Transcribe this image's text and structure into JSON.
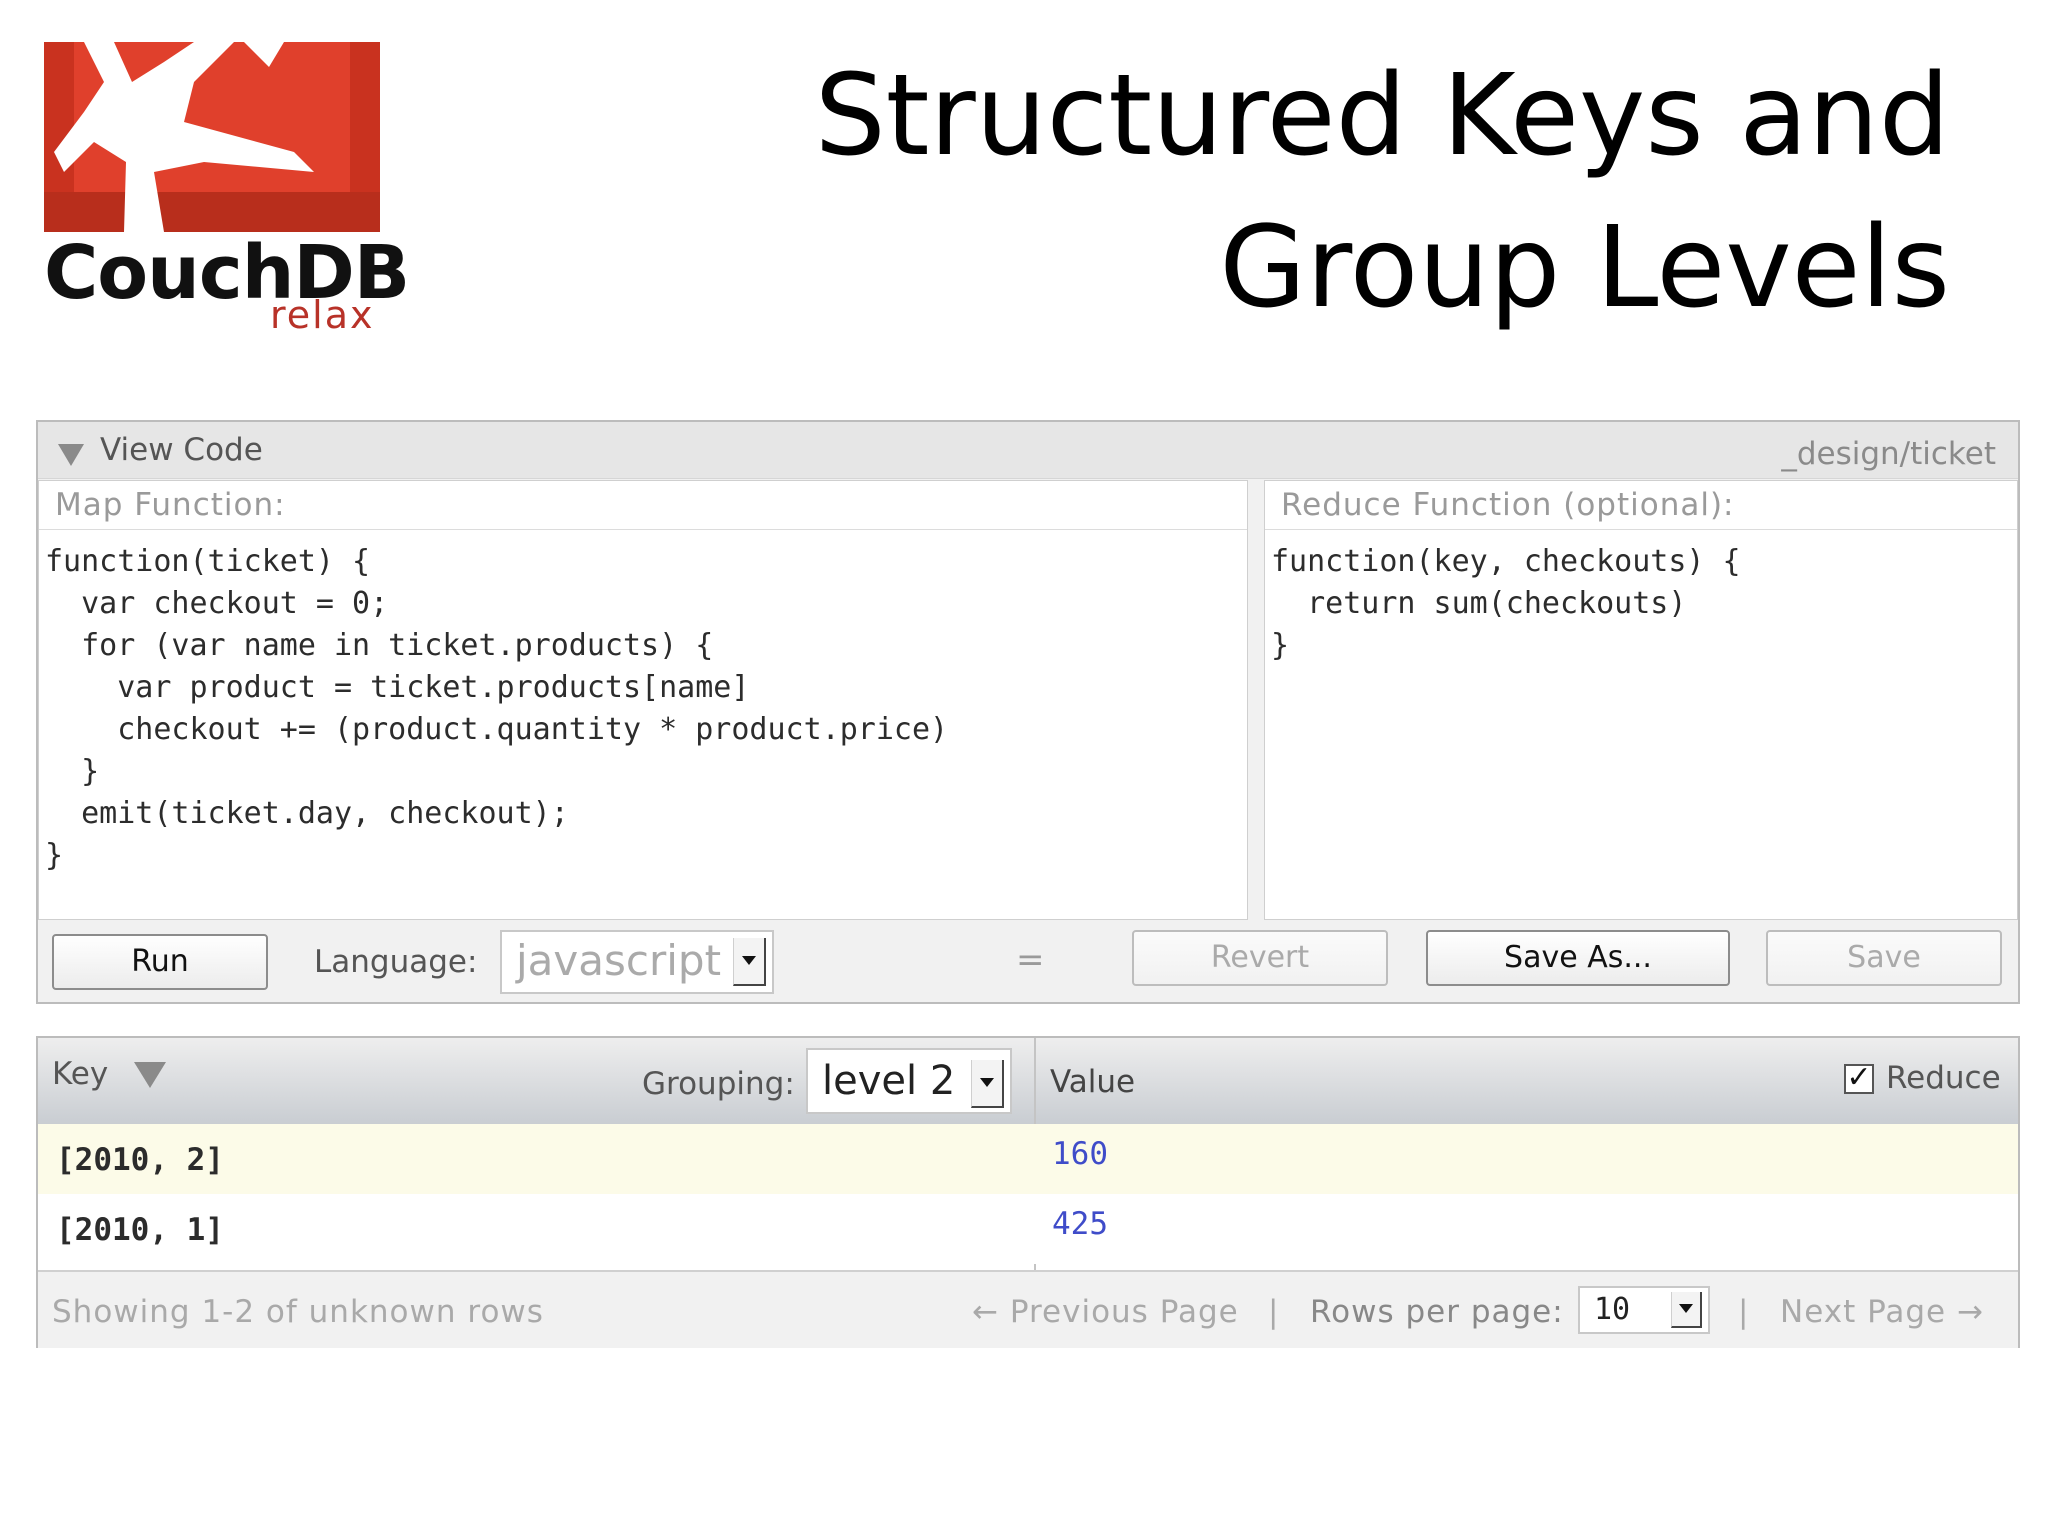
{
  "logo": {
    "wordmark": "CouchDB",
    "tagline": "relax"
  },
  "slide": {
    "title_line1": "Structured Keys and",
    "title_line2": "Group Levels"
  },
  "view_code": {
    "title": "View Code",
    "design_doc": "_design/ticket",
    "map_label": "Map Function:",
    "map_code": "function(ticket) {\n  var checkout = 0;\n  for (var name in ticket.products) {\n    var product = ticket.products[name]\n    checkout += (product.quantity * product.price)\n  }\n  emit(ticket.day, checkout);\n}",
    "reduce_label": "Reduce Function (optional):",
    "reduce_code": "function(key, checkouts) {\n  return sum(checkouts)\n}",
    "run_label": "Run",
    "language_label": "Language:",
    "language_value": "javascript",
    "equals": "=",
    "revert_label": "Revert",
    "save_as_label": "Save As...",
    "save_label": "Save"
  },
  "results": {
    "key_header": "Key",
    "grouping_label": "Grouping:",
    "grouping_value": "level 2",
    "value_header": "Value",
    "reduce_label": "Reduce",
    "reduce_checked": true,
    "rows": [
      {
        "key": "[2010, 2]",
        "value": "160"
      },
      {
        "key": "[2010, 1]",
        "value": "425"
      }
    ],
    "footer": {
      "showing": "Showing 1-2 of unknown rows",
      "prev": "← Previous Page",
      "separator": "|",
      "rows_per_page_label": "Rows per page:",
      "rows_per_page_value": "10",
      "next": "Next Page →"
    }
  },
  "colors": {
    "brand_red": "#e0402c",
    "value_blue": "#3f4cc9",
    "row_highlight": "#fcfbe8"
  },
  "icons": [
    "couchdb-logo-icon",
    "collapse-triangle-icon",
    "sort-triangle-icon",
    "dropdown-caret-icon",
    "checkbox-checked-icon"
  ]
}
